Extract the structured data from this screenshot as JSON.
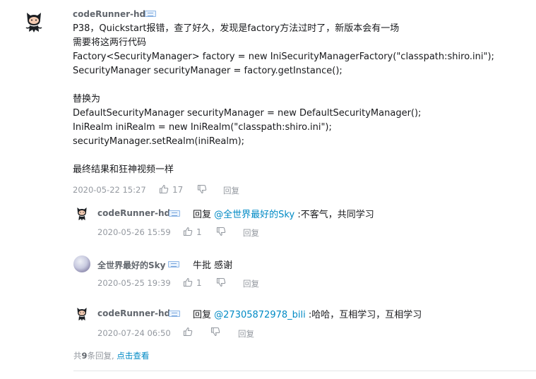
{
  "comment": {
    "username": "codeRunner-hd",
    "lines": [
      "P38，Quickstart报错，查了好久，发现是factory方法过时了，新版本会有一场",
      "需要将这两行代码",
      "Factory<SecurityManager> factory = new IniSecurityManagerFactory(\"classpath:shiro.ini\");",
      "SecurityManager securityManager = factory.getInstance();",
      "",
      "替换为",
      "DefaultSecurityManager securityManager = new DefaultSecurityManager();",
      "IniRealm iniRealm = new IniRealm(\"classpath:shiro.ini\");",
      "securityManager.setRealm(iniRealm);",
      "",
      "最终结果和狂神视频一样"
    ],
    "date": "2020-05-22 15:27",
    "likes": "17",
    "reply_label": "回复"
  },
  "replies": [
    {
      "username": "codeRunner-hd",
      "avatar": "octocat-icon",
      "prefix": "回复",
      "mention": "@全世界最好的Sky",
      "text": ":不客气，共同学习",
      "date": "2020-05-26 15:59",
      "likes": "1",
      "reply_label": "回复"
    },
    {
      "username": "全世界最好的Sky",
      "avatar": "sky-avatar",
      "prefix": "",
      "mention": "",
      "text": "牛批 感谢",
      "date": "2020-05-25 19:39",
      "likes": "1",
      "reply_label": "回复"
    },
    {
      "username": "codeRunner-hd",
      "avatar": "octocat-icon",
      "prefix": "回复",
      "mention": "@27305872978_bili",
      "text": ":哈哈，互相学习，互相学习",
      "date": "2020-07-24 06:50",
      "likes": "",
      "reply_label": "回复"
    }
  ],
  "footer": {
    "prefix": "共",
    "count": "9",
    "suffix": "条回复,",
    "more_label": "点击查看"
  },
  "colors": {
    "mention": "#008ac5",
    "meta": "#9499a0",
    "username": "#61666d"
  }
}
